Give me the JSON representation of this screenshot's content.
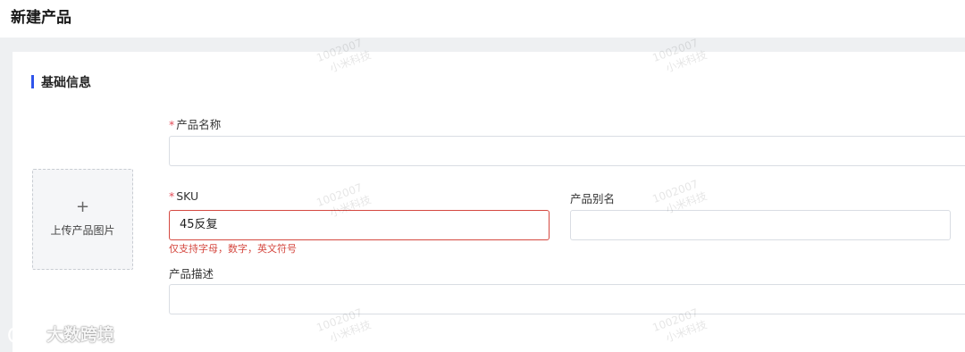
{
  "page": {
    "title": "新建产品"
  },
  "section": {
    "title": "基础信息"
  },
  "upload": {
    "plus": "+",
    "label": "上传产品图片"
  },
  "form": {
    "product_name": {
      "required_mark": "*",
      "label": "产品名称",
      "value": ""
    },
    "sku": {
      "required_mark": "*",
      "label": "SKU",
      "value": "45反复",
      "error": "仅支持字母，数字，英文符号"
    },
    "alias": {
      "label": "产品别名",
      "value": ""
    },
    "description": {
      "label": "产品描述",
      "value": ""
    }
  },
  "watermark": {
    "id": "1002007",
    "text": "小米科技"
  },
  "brand": {
    "text": "大数跨境"
  },
  "colors": {
    "accent": "#2f54eb",
    "error": "#d54941",
    "required": "#e34d59",
    "background_gray": "#eef0f2"
  }
}
